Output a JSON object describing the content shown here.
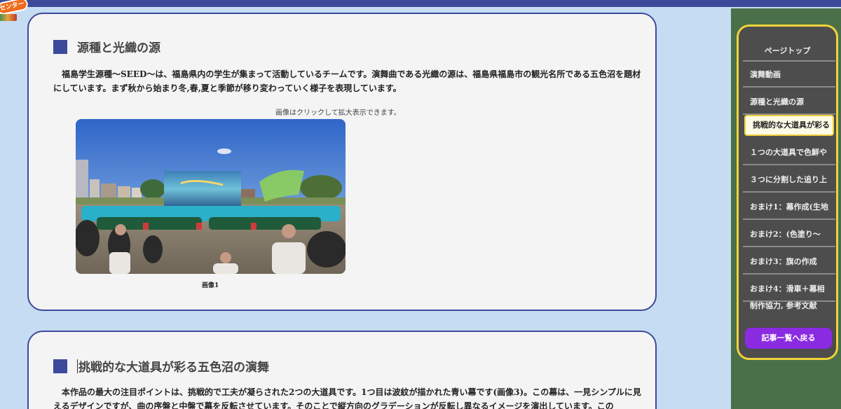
{
  "logo": {
    "text": "センター"
  },
  "section1": {
    "title": "源種と光織の源",
    "paragraph": "福島学生源種〜SEED〜は、福島県内の学生が集まって活動しているチームです。演舞曲である光織の源は、福島県福島市の観光名所である五色沼を題材にしています。まず秋から始まり冬,春,夏と季節が移り変わっていく様子を表現しています。",
    "image_note": "画像はクリックして拡大表示できます。",
    "image_caption": "画像1"
  },
  "section2": {
    "title": "挑戦的な大道具が彩る五色沼の演舞",
    "paragraph": "本作品の最大の注目ポイントは、挑戦的で工夫が凝らされた2つの大道具です。1つ目は波紋が描かれた青い幕です(画像3)。この幕は、一見シンプルに見えるデザインですが、曲の序盤と中盤で幕を反転させています。そのことで縦方向のグラデーションが反転し異なるイメージを演出しています。この"
  },
  "sidebar": {
    "header": "ページトップ",
    "items": [
      {
        "label": "演舞動画"
      },
      {
        "label": "源種と光織の源"
      },
      {
        "label": "挑戦的な大道具が彩る"
      },
      {
        "label": "１つの大道具で色鮮や"
      },
      {
        "label": "３つに分割した追り上"
      },
      {
        "label": "おまけ1：幕作成(生地"
      },
      {
        "label": "おまけ2：(色塗り〜"
      },
      {
        "label": "おまけ3：旗の作成"
      },
      {
        "label": "おまけ4：滑車＋幕相"
      },
      {
        "label": "制作協力, 参考文献"
      }
    ],
    "back_button": "記事一覧へ戻る"
  },
  "colors": {
    "topbar": "#3d4a9a",
    "card_border": "#3b4a9a",
    "sidebar_border": "#f0d23a",
    "back_button": "#8a2be2",
    "page_background": "#c6dcf2"
  }
}
